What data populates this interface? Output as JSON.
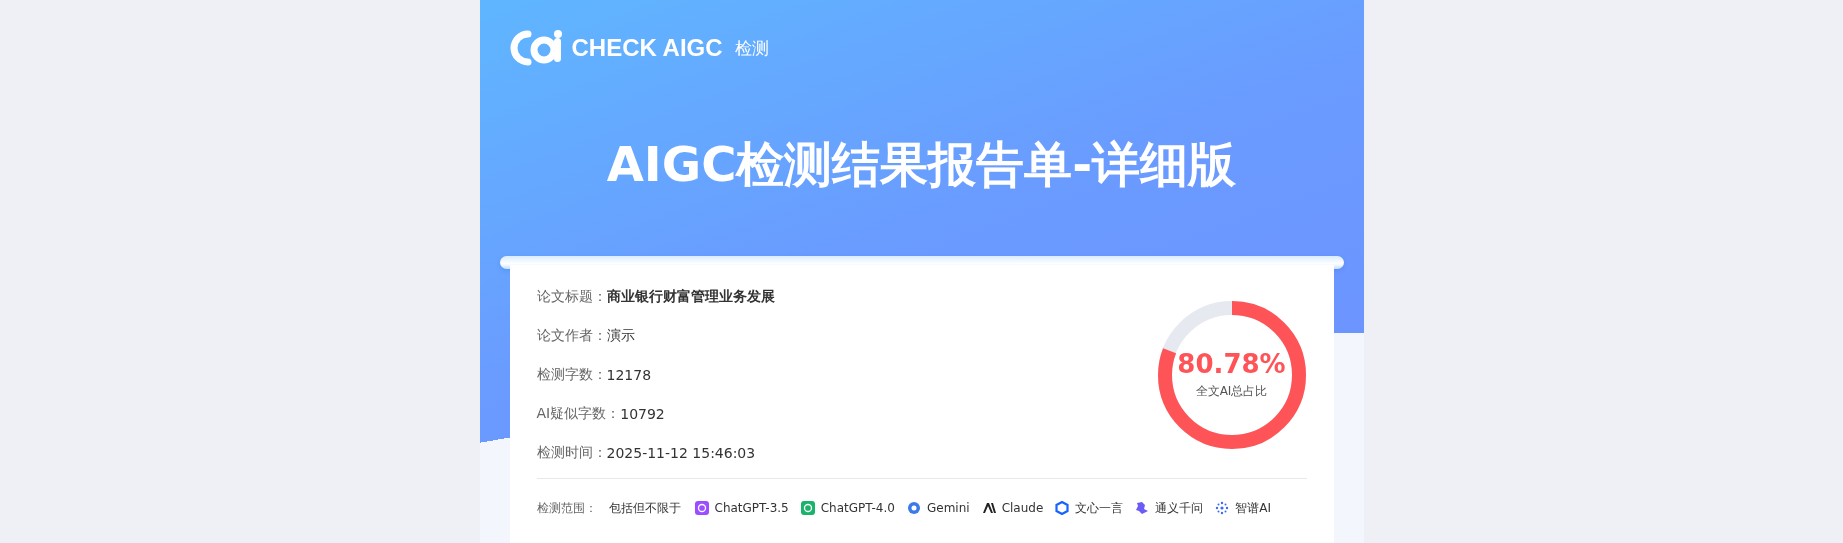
{
  "brand": {
    "name": "CHECK AIGC",
    "suffix": "检测"
  },
  "title": "AIGC检测结果报告单-详细版",
  "info": [
    {
      "label": "论文标题：",
      "value": "商业银行财富管理业务发展",
      "bold": true
    },
    {
      "label": "论文作者：",
      "value": "演示",
      "bold": false
    },
    {
      "label": "检测字数：",
      "value": "12178",
      "bold": false
    },
    {
      "label": "AI疑似字数：",
      "value": "10792",
      "bold": false
    },
    {
      "label": "检测时间：",
      "value": "2025-11-12 15:46:03",
      "bold": false
    }
  ],
  "gauge": {
    "value": "80.78%",
    "caption": "全文AI总占比",
    "level": 0.8078
  },
  "scope": {
    "label": "检测范围：",
    "intro": "包括但不限于",
    "models": [
      {
        "name": "ChatGPT-3.5",
        "kind": "square",
        "color": "#9b4dff"
      },
      {
        "name": "ChatGPT-4.0",
        "kind": "square",
        "color": "#19b36b"
      },
      {
        "name": "Gemini",
        "kind": "circle",
        "color": "#3b7be8"
      },
      {
        "name": "Claude",
        "kind": "wedge",
        "color": "#222222"
      },
      {
        "name": "文心一言",
        "kind": "hexagon",
        "color": "#1663ff"
      },
      {
        "name": "通义千问",
        "kind": "star",
        "color": "#6b5cf5"
      },
      {
        "name": "智谱AI",
        "kind": "burst",
        "color": "#3d6cf0"
      }
    ]
  }
}
